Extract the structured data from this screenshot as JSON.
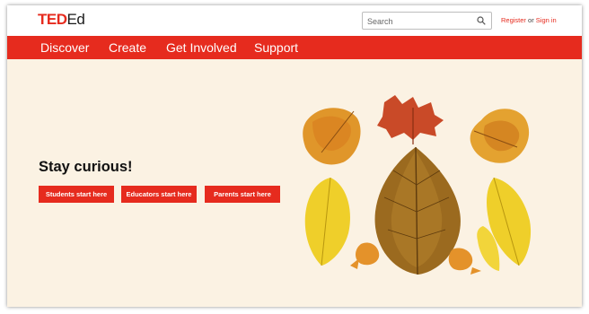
{
  "header": {
    "logo_ted": "TED",
    "logo_ed": "Ed",
    "search_placeholder": "Search",
    "register_label": "Register",
    "or_label": "or",
    "signin_label": "Sign in"
  },
  "nav": {
    "items": [
      {
        "label": "Discover"
      },
      {
        "label": "Create"
      },
      {
        "label": "Get Involved"
      },
      {
        "label": "Support"
      }
    ]
  },
  "hero": {
    "headline": "Stay curious!",
    "buttons": [
      {
        "label": "Students start here"
      },
      {
        "label": "Educators start here"
      },
      {
        "label": "Parents start here"
      }
    ]
  },
  "colors": {
    "brand_red": "#e62b1e",
    "hero_background": "#fbf2e3"
  },
  "icons": {
    "search": "search-icon",
    "artwork": "leaf-owl-illustration"
  }
}
